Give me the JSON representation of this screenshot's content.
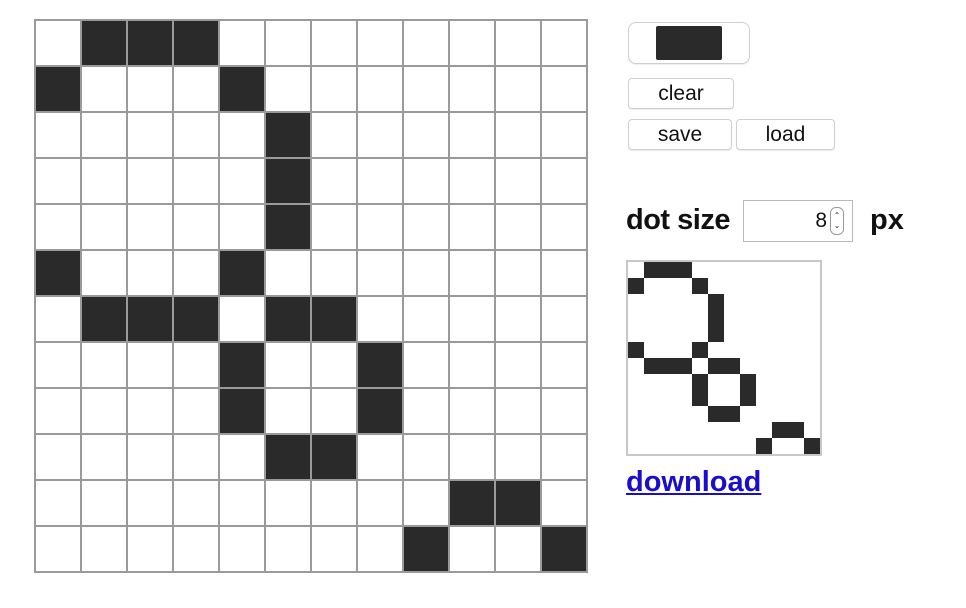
{
  "grid": {
    "columns": 12,
    "rows": 12,
    "cells": [
      "011100000000",
      "100010000000",
      "000001000000",
      "000001000000",
      "000001000000",
      "100010000000",
      "011101100000",
      "000010010000",
      "000010010000",
      "000001100000",
      "000000000110",
      "000000001001"
    ]
  },
  "controls": {
    "current_color": "#2a2a2a",
    "clear_label": "clear",
    "save_label": "save",
    "load_label": "load",
    "dot_size_label": "dot size",
    "dot_size_value": "8",
    "dot_size_unit": "px",
    "stepper_up": "⌃",
    "stepper_down": "⌄"
  },
  "preview": {
    "dot_size": 8
  },
  "download_label": "download",
  "colors": {
    "filled": "#2a2a2a",
    "empty": "#ffffff",
    "grid_line": "#9a9a9a",
    "link": "#1a0dcc"
  }
}
